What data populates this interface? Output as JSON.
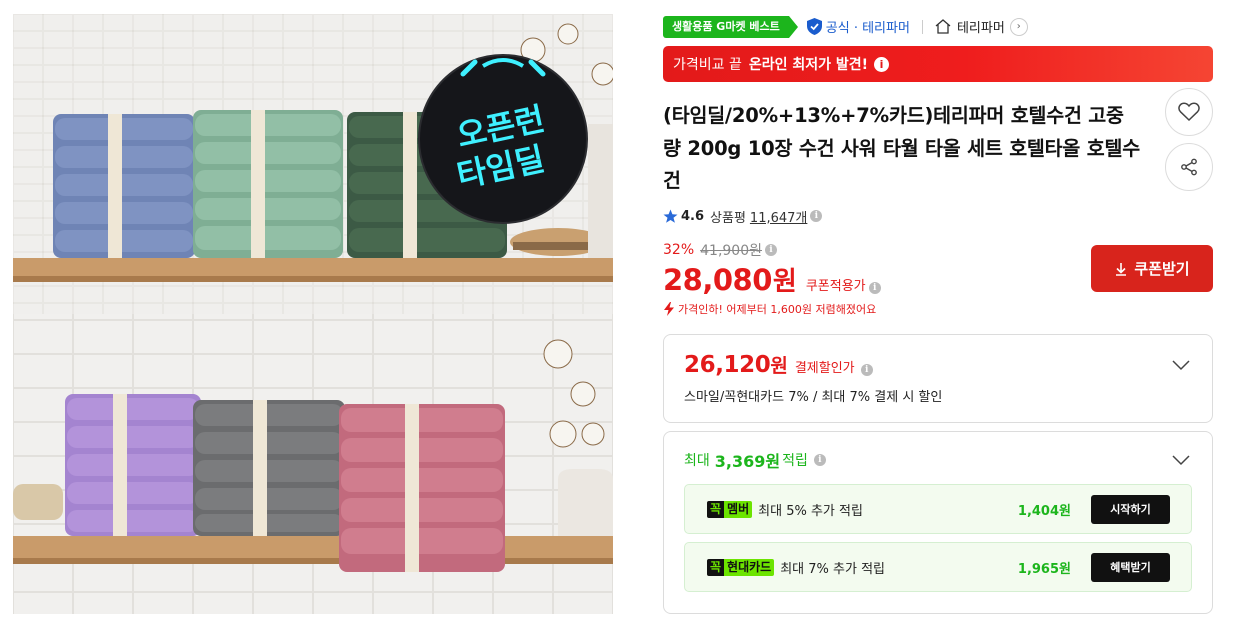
{
  "image": {
    "alt": "",
    "stamp_line1": "오픈런",
    "stamp_line2": "타임딜"
  },
  "badges": {
    "category": "생활용품 G마켓 베스트",
    "official": "공식 · 테리파머",
    "store": "테리파머"
  },
  "promo_banner": {
    "text": "가격비교 끝",
    "bold": "온라인 최저가 발견!",
    "info": "i"
  },
  "product": {
    "title": "(타임딜/20%+13%+7%카드)테리파머 호텔수건 고중량 200g 10장 수건 사워 타월 타올 세트 호텔타올 호텔수건"
  },
  "rating": {
    "score": "4.6",
    "label": "상품평",
    "count": "11,647개"
  },
  "price": {
    "discount_rate": "32%",
    "original": "41,900원",
    "current": "28,080",
    "unit": "원",
    "coupon_applied_label": "쿠폰적용가",
    "drop_text": "가격인하! 어제부터 1,600원 저렴해졌어요",
    "coupon_button": "쿠폰받기"
  },
  "payment": {
    "price": "26,120",
    "unit": "원",
    "label": "결제할인가",
    "desc": "스마일/꼭현대카드 7% / 최대 7% 결제 시 할인"
  },
  "reward": {
    "prefix": "최대",
    "amount": "3,369원",
    "suffix": "적립",
    "items": [
      {
        "tag_k": "꼭",
        "tag_n": "멤버",
        "text": "최대 5% 추가 적립",
        "amount": "1,404원",
        "button": "시작하기"
      },
      {
        "tag_k": "꼭",
        "tag_n": "현대카드",
        "text": "최대 7% 추가 적립",
        "amount": "1,965원",
        "button": "혜택받기"
      }
    ]
  },
  "colors": {
    "accent_red": "#e31a1a",
    "green": "#1cb51c",
    "neon": "#6ce400"
  },
  "icons": [
    "shield-icon",
    "home-icon",
    "chevron-right-icon",
    "info-icon",
    "heart-icon",
    "share-icon",
    "star-icon",
    "bolt-icon",
    "download-icon",
    "chevron-down-icon"
  ]
}
